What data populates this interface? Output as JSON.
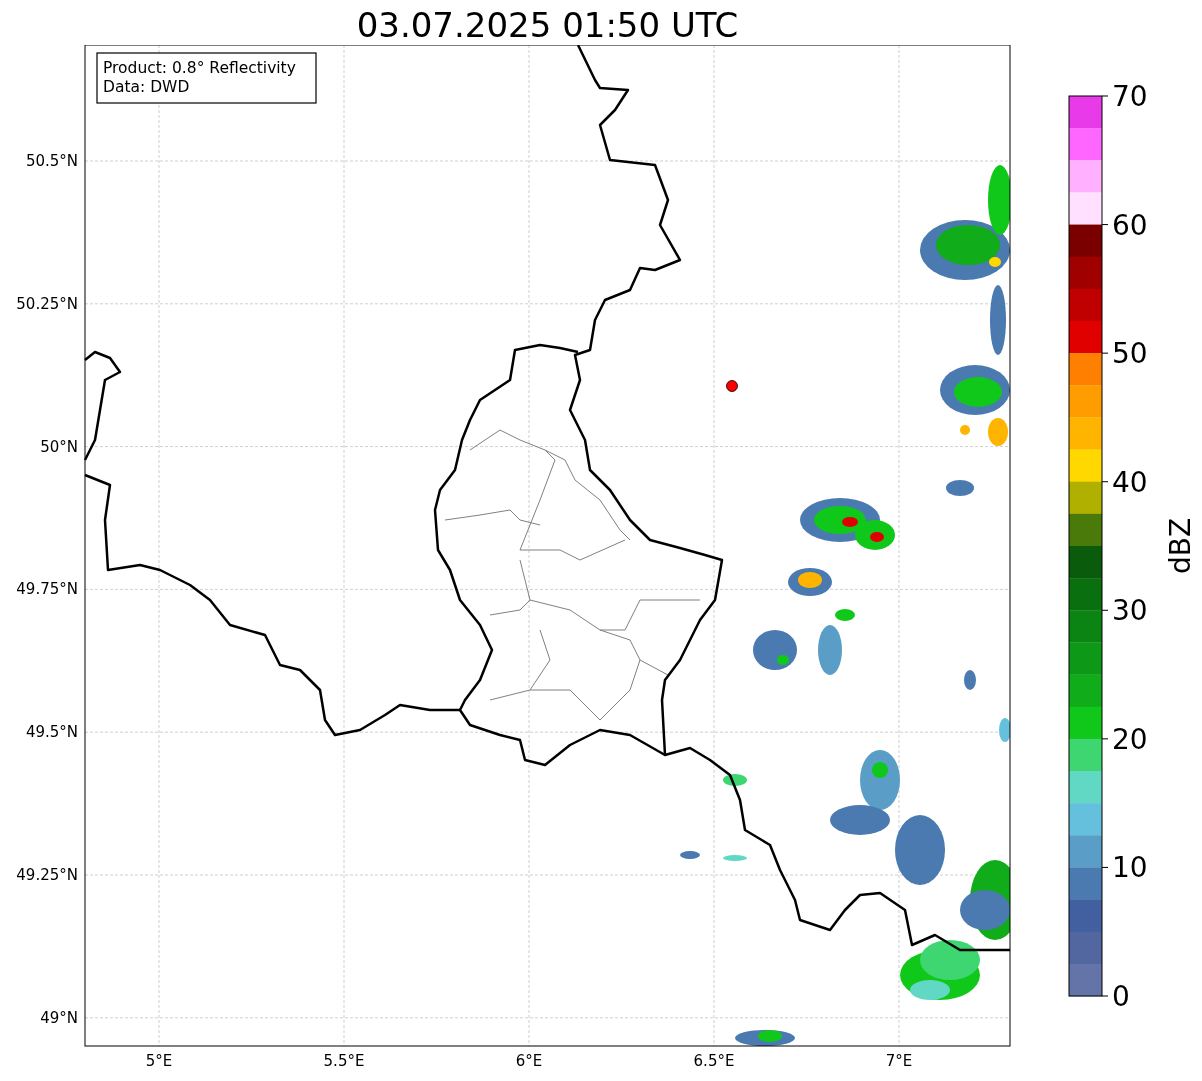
{
  "title": "03.07.2025 01:50 UTC",
  "info_box": {
    "lines": [
      "Product: 0.8° Reflectivity",
      "Data: DWD"
    ]
  },
  "map": {
    "lon_ticks": [
      "5°E",
      "5.5°E",
      "6°E",
      "6.5°E",
      "7°E"
    ],
    "lat_ticks": [
      "50.5°N",
      "50.25°N",
      "50°N",
      "49.75°N",
      "49.5°N",
      "49.25°N",
      "49°N"
    ]
  },
  "colorbar": {
    "label": "dBZ",
    "ticks": [
      "70",
      "60",
      "50",
      "40",
      "30",
      "20",
      "10",
      "0"
    ],
    "bins": [
      {
        "color": "#e83ae8"
      },
      {
        "color": "#ff66ff"
      },
      {
        "color": "#ffb0ff"
      },
      {
        "color": "#ffe0ff"
      },
      {
        "color": "#7a0000"
      },
      {
        "color": "#a00000"
      },
      {
        "color": "#c00000"
      },
      {
        "color": "#e00000"
      },
      {
        "color": "#ff8000"
      },
      {
        "color": "#ff9c00"
      },
      {
        "color": "#ffb400"
      },
      {
        "color": "#ffd800"
      },
      {
        "color": "#b0b000"
      },
      {
        "color": "#4a7a0a"
      },
      {
        "color": "#0a5c0c"
      },
      {
        "color": "#0a700f"
      },
      {
        "color": "#0c8414"
      },
      {
        "color": "#0e9818"
      },
      {
        "color": "#10ac1a"
      },
      {
        "color": "#10c81a"
      },
      {
        "color": "#3dd670"
      },
      {
        "color": "#60d8c4"
      },
      {
        "color": "#64c0dc"
      },
      {
        "color": "#5a9ec8"
      },
      {
        "color": "#4a7ab0"
      },
      {
        "color": "#4260a0"
      },
      {
        "color": "#5266a0"
      },
      {
        "color": "#6474a8"
      }
    ]
  }
}
